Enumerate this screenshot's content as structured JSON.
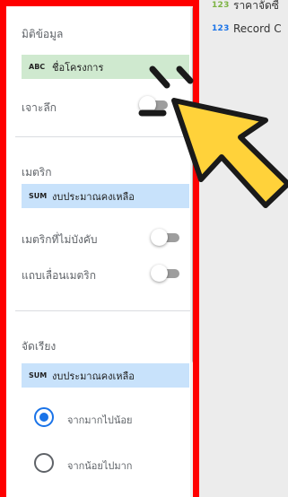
{
  "field_list": [
    {
      "type": "123",
      "label": "ราคาจัดซื้"
    },
    {
      "type": "123",
      "label": "Record C"
    }
  ],
  "panel": {
    "dimension_section": {
      "title": "มิติข้อมูล",
      "chip": {
        "type": "ABC",
        "label": "ชื่อโครงการ"
      },
      "drill_label": "เจาะลึก"
    },
    "metric_section": {
      "title": "เมตริก",
      "chip": {
        "type": "SUM",
        "label": "งบประมาณคงเหลือ"
      },
      "optional_label": "เมตริกที่ไม่บังคับ",
      "slider_label": "แถบเลื่อนเมตริก"
    },
    "sort_section": {
      "title": "จัดเรียง",
      "chip": {
        "type": "SUM",
        "label": "งบประมาณคงเหลือ"
      },
      "options": [
        "จากมากไปน้อย",
        "จากน้อยไปมาก"
      ],
      "selected_option": "จากมากไปน้อย"
    }
  },
  "colors": {
    "highlight_border": "#ff0000",
    "dimension_chip": "#cfe9cf",
    "metric_chip": "#c8e2fb",
    "accent": "#1a73e8",
    "pointer_fill": "#ffd23a"
  },
  "icons": [
    "cursor-arrow-icon",
    "click-burst-icon"
  ]
}
